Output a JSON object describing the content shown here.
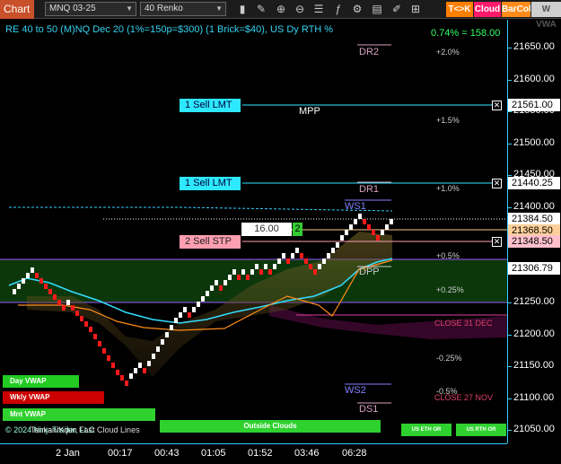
{
  "toolbar": {
    "tab_label": "Chart",
    "instrument": "MNQ 03-25",
    "bar_type": "40 Renko",
    "buttons": {
      "tk": "T<>K",
      "cloud": "Cloud",
      "barcol": "BarCol",
      "vwap": "W VWA"
    },
    "icons": [
      "bars-icon",
      "draw-icon",
      "zoom-in-icon",
      "zoom-out-icon",
      "properties-icon",
      "indicators-icon",
      "strategies-icon",
      "templates-icon",
      "drawing-tools-icon",
      "chart-trader-icon"
    ]
  },
  "chart": {
    "title": "RE 40 to 50 (M)NQ Dec 20 (1%=150p=$300) (1 Brick=$40), US Dy RTH %",
    "change": "0.74% = 158.00",
    "watermark": "© 2024 NinjaTrader, LLC",
    "watermark2": "Tenkan/Kijun Fast Cloud Lines",
    "colors": {
      "accent": "#33ccff",
      "sell": "#2ee8ff",
      "stop": "#ff9eb0",
      "up_brick": "#ffffff",
      "down_brick": "#ff1a1a",
      "target": "#33cc33"
    }
  },
  "y_axis": {
    "ticks": [
      "21650.00",
      "21600.00",
      "21550.00",
      "21500.00",
      "21450.00",
      "21400.00",
      "21350.00",
      "21300.00",
      "21250.00",
      "21200.00",
      "21150.00",
      "21100.00",
      "21050.00"
    ],
    "price_tags": [
      {
        "value": "21561.00",
        "style": "order"
      },
      {
        "value": "21440.25",
        "style": "order"
      },
      {
        "value": "21384.50",
        "style": "last"
      },
      {
        "value": "21368.50",
        "style": "pivot"
      },
      {
        "value": "21348.50",
        "style": "stop"
      },
      {
        "value": "21306.79",
        "style": "vwap"
      }
    ]
  },
  "x_axis": {
    "ticks": [
      "2 Jan",
      "00:17",
      "00:43",
      "01:05",
      "01:52",
      "03:46",
      "06:28"
    ]
  },
  "orders": [
    {
      "label": "1 Sell LMT",
      "price": 21561.0
    },
    {
      "label": "1 Sell LMT",
      "price": 21440.25
    },
    {
      "label": "2 Sell STP",
      "price": 21348.5
    }
  ],
  "position": {
    "qty_input": "16.00",
    "badge": "2"
  },
  "levels": [
    {
      "label": "DR2",
      "price": 21668
    },
    {
      "label": "MPP",
      "price": 21552
    },
    {
      "label": "DR1",
      "price": 21437
    },
    {
      "label": "WS1",
      "price": 21413
    },
    {
      "label": "DPP",
      "price": 21311
    },
    {
      "label": "WS2",
      "price": 21127
    },
    {
      "label": "DS1",
      "price": 21101
    }
  ],
  "percent_labels": [
    "+2.0%",
    "+1.5%",
    "+1.0%",
    "+0.5%",
    "+0.25%",
    "-0.25%",
    "-0.5%"
  ],
  "close_labels": [
    "CLOSE 31 DEC",
    "CLOSE 27 NOV"
  ],
  "legend_buttons": [
    "Day VWAP",
    "Wkly VWAP",
    "Mnt VWAP",
    "Outside Clouds"
  ],
  "session_buttons": [
    "US ETH OR",
    "US RTH OR"
  ]
}
